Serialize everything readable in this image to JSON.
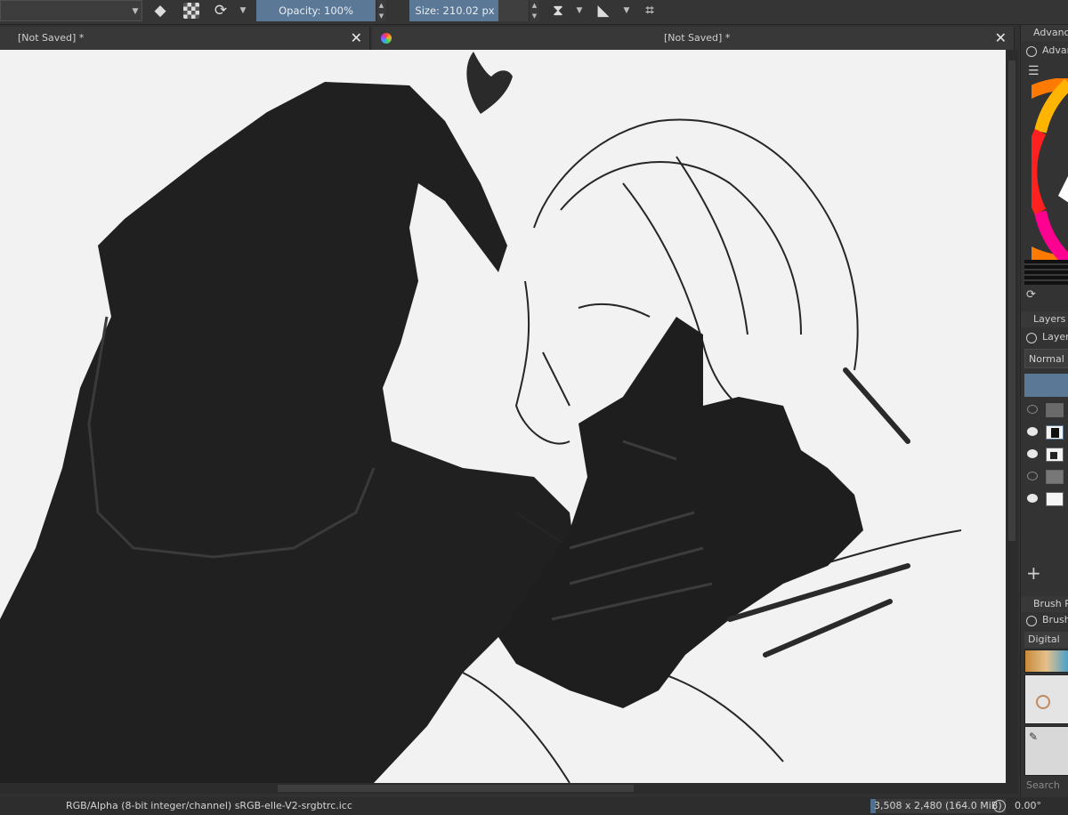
{
  "toolbar": {
    "eraser_icon": "eraser-icon",
    "alpha_icon": "alpha-lock-icon",
    "reload_icon": "reload-icon",
    "opacity": {
      "label": "Opacity: 100%",
      "value_percent": 100
    },
    "size": {
      "label": "Size: 210.02 px"
    },
    "mirror_h_icon": "mirror-horizontal-icon",
    "mirror_v_icon": "mirror-vertical-icon",
    "crop_icon": "crop-icon"
  },
  "tabs": [
    {
      "label": "[Not Saved]  *"
    },
    {
      "label": "[Not Saved]  *"
    }
  ],
  "docker": {
    "color_section": {
      "title": "Advanced",
      "subtitle": "Advan"
    },
    "layers_section": {
      "title": "Layers",
      "subtitle": "Layers",
      "blend_mode": "Normal",
      "layers": [
        {
          "visible": false
        },
        {
          "visible": true,
          "selected": true
        },
        {
          "visible": true
        },
        {
          "visible": false
        },
        {
          "visible": true
        }
      ],
      "add_icon": "plus-icon",
      "add_label": "+"
    },
    "brush_section": {
      "title": "Brush Pr",
      "subtitle": "Brush",
      "tag": "Digital",
      "search_placeholder": "Search"
    }
  },
  "status": {
    "color_space": "RGB/Alpha (8-bit integer/channel)  sRGB-elle-V2-srgbtrc.icc",
    "dimensions": "3,508 x 2,480 (164.0 MiB)",
    "rotation": "0.00°"
  },
  "colors": {
    "accent": "#5b7896",
    "panel": "#333333",
    "canvas": "#f2f2f2"
  }
}
